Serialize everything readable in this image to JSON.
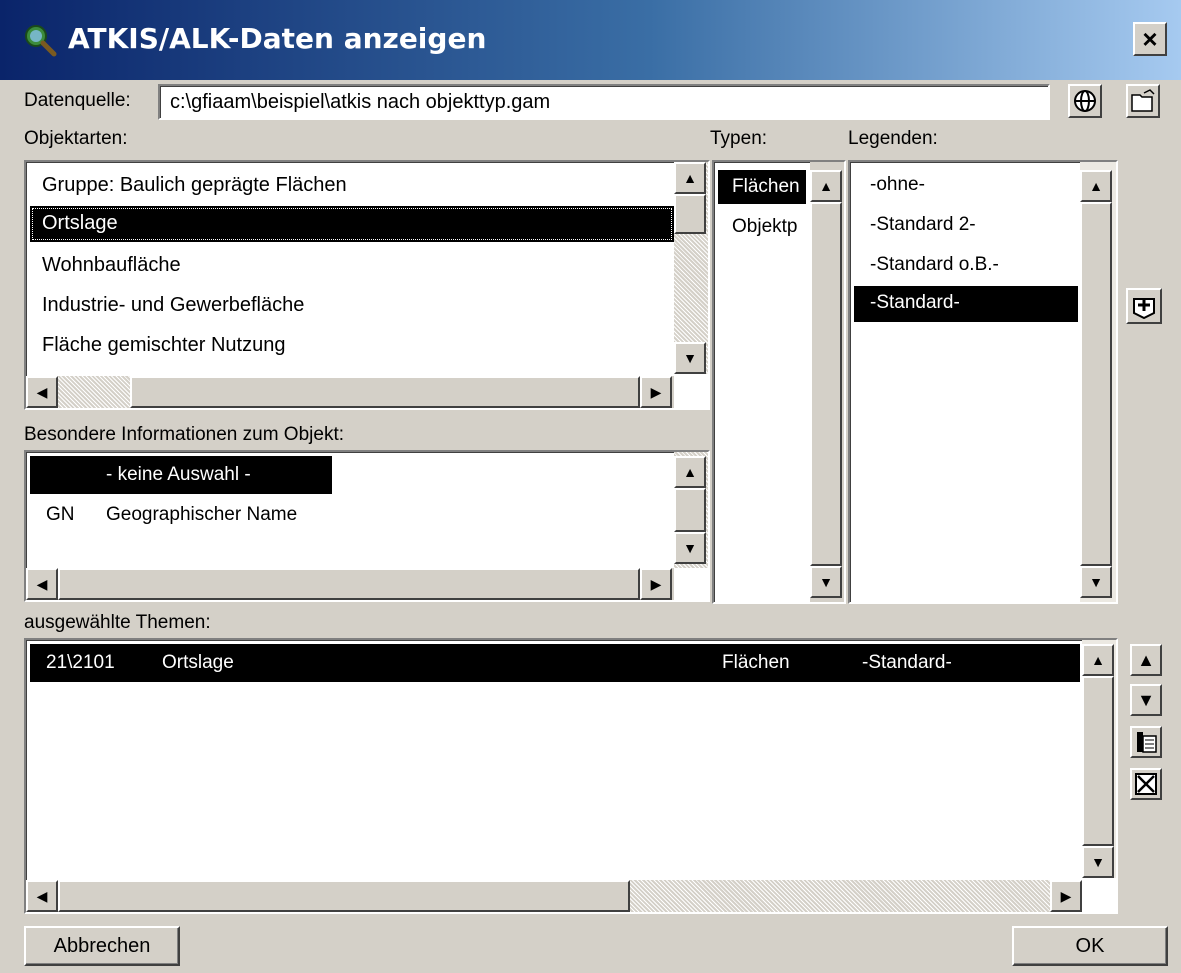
{
  "window": {
    "title": "ATKIS/ALK-Daten anzeigen",
    "close_label": "×"
  },
  "datasource": {
    "label": "Datenquelle:",
    "value": "c:\\gfiaam\\beispiel\\atkis nach objekttyp.gam"
  },
  "objektarten": {
    "label": "Objektarten:",
    "items": [
      "Gruppe: Baulich geprägte Flächen",
      "Ortslage",
      "Wohnbaufläche",
      "Industrie- und Gewerbefläche",
      "Fläche gemischter Nutzung"
    ],
    "selected_index": 1
  },
  "typen": {
    "label": "Typen:",
    "items": [
      "Flächen",
      "Objektp"
    ],
    "selected_index": 0
  },
  "legenden": {
    "label": "Legenden:",
    "items": [
      "-ohne-",
      "-Standard 2-",
      "-Standard o.B.-",
      "-Standard-"
    ],
    "selected_index": 3
  },
  "besondere": {
    "label": "Besondere Informationen zum Objekt:",
    "rows": [
      {
        "code": "",
        "name": "- keine Auswahl -"
      },
      {
        "code": "GN",
        "name": "Geographischer Name"
      }
    ],
    "selected_index": 0
  },
  "themen": {
    "label": "ausgewählte Themen:",
    "rows": [
      {
        "code": "21\\2101",
        "name": "Ortslage",
        "typ": "Flächen",
        "legende": "-Standard-"
      }
    ]
  },
  "buttons": {
    "cancel": "Abbrechen",
    "ok": "OK"
  },
  "icons": {
    "app": "magnifier-globe-icon",
    "datasource_info": "globe-icon",
    "datasource_browse": "open-folder-icon",
    "add_theme": "add-theme-icon",
    "move_up": "arrow-up-icon",
    "move_down": "arrow-down-icon",
    "properties": "properties-icon",
    "delete": "delete-icon"
  }
}
